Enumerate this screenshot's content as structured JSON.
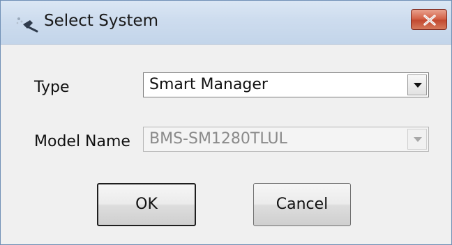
{
  "window": {
    "title": "Select System"
  },
  "form": {
    "type_label": "Type",
    "type_value": "Smart Manager",
    "model_label": "Model Name",
    "model_value": "BMS-SM1280TLUL"
  },
  "buttons": {
    "ok_label": "OK",
    "cancel_label": "Cancel"
  },
  "icons": {
    "app": "wrench-tool-icon",
    "close": "close-icon",
    "dropdown": "chevron-down-icon"
  },
  "colors": {
    "titlebar": "#cddcee",
    "close_button": "#c24a31",
    "dialog_background": "#f0f0f0",
    "disabled_text": "#8a8a8a"
  }
}
